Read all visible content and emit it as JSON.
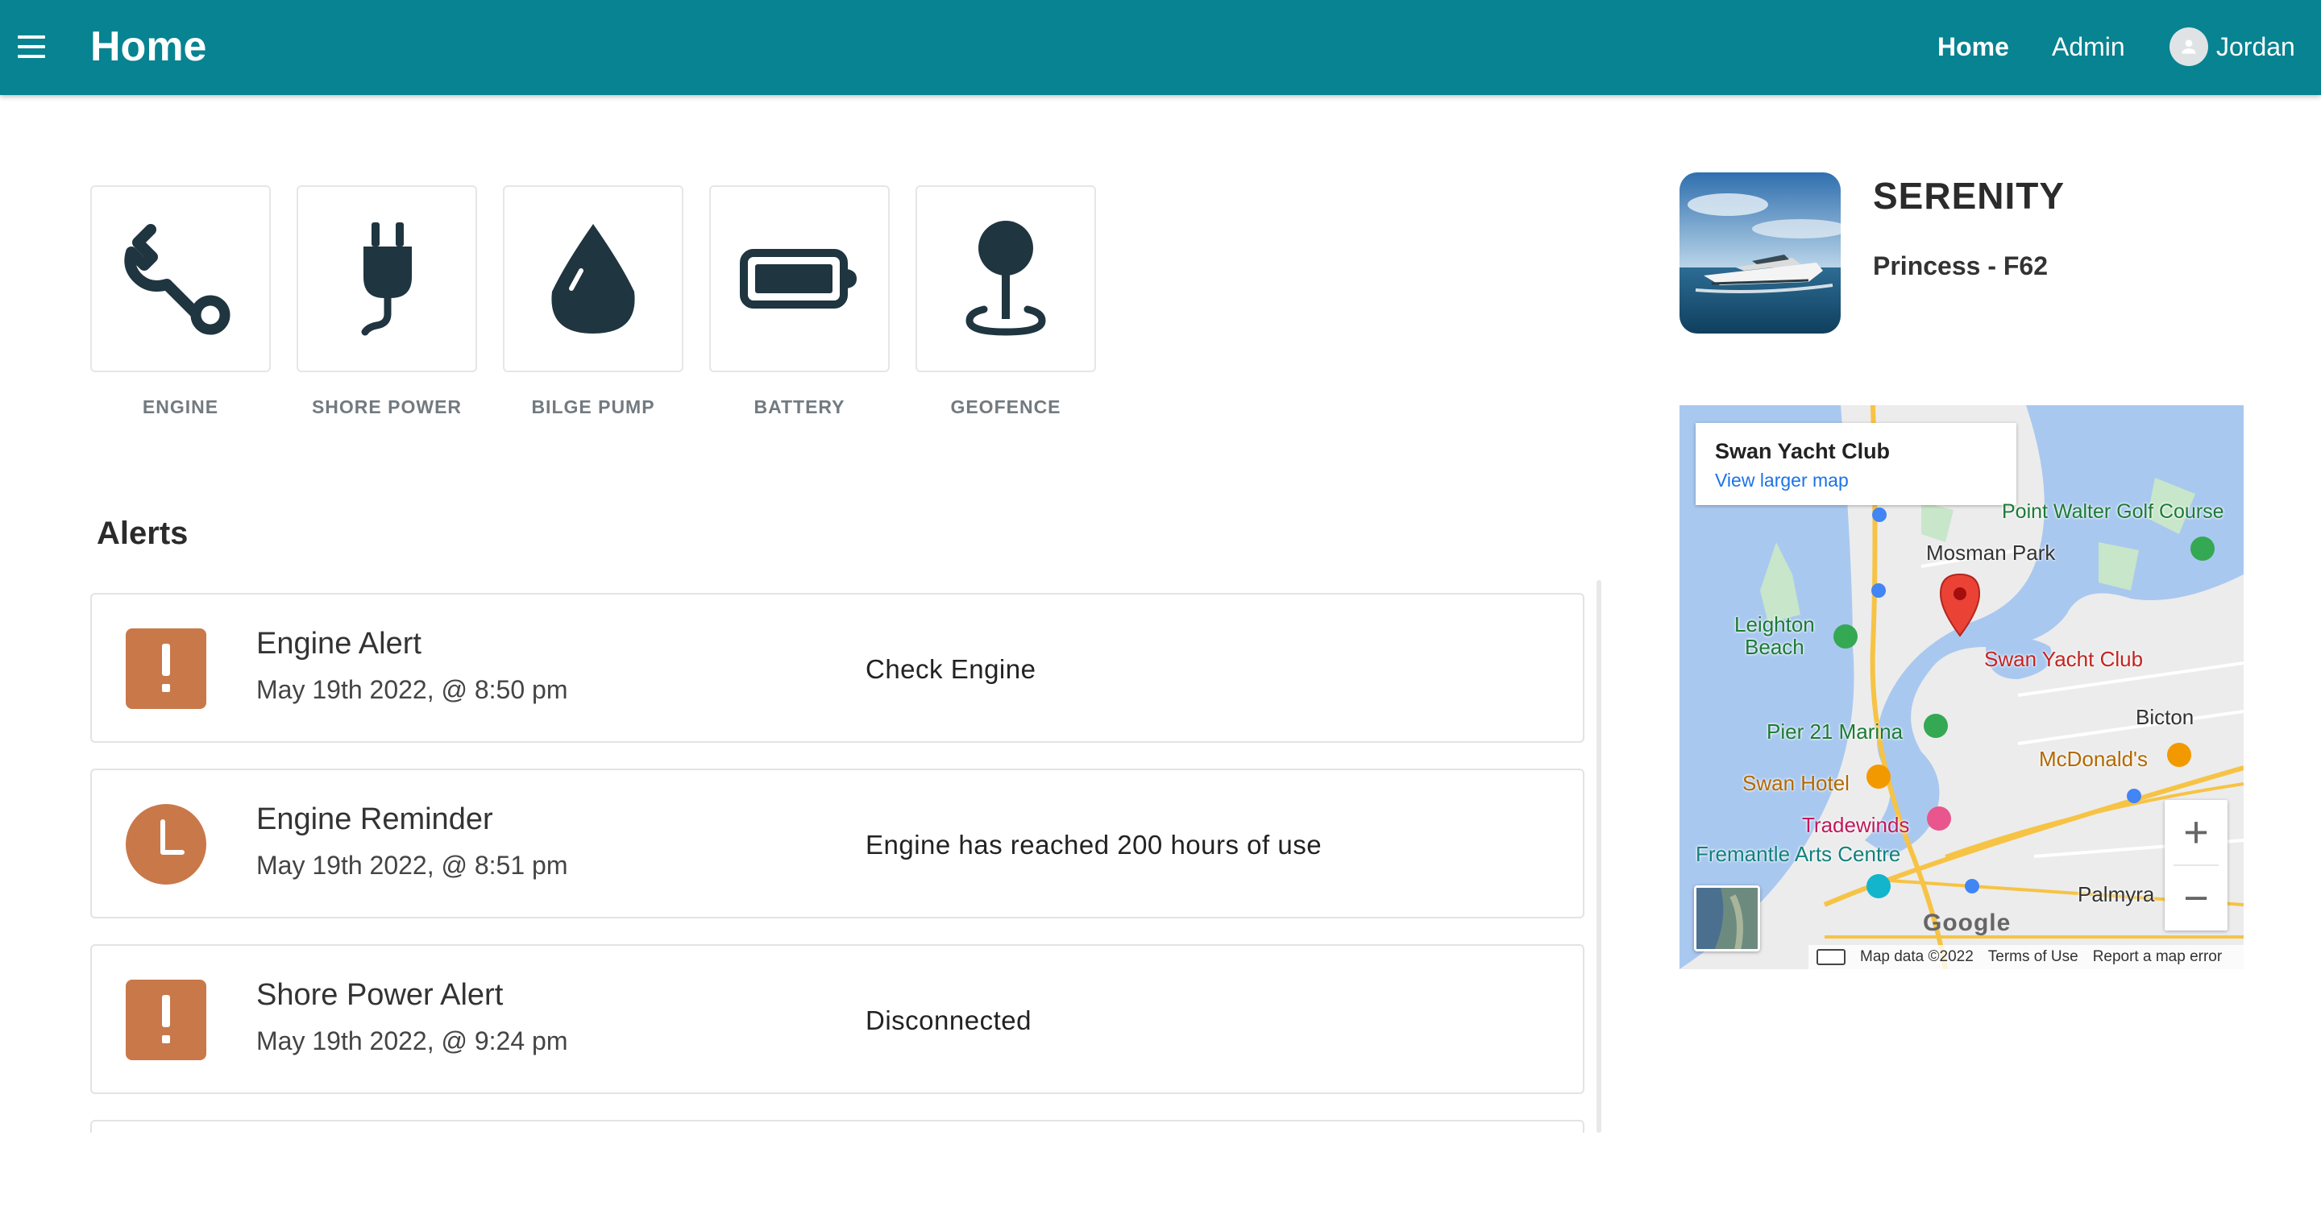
{
  "header": {
    "title": "Home",
    "nav": {
      "home": "Home",
      "admin": "Admin"
    },
    "user_name": "Jordan"
  },
  "status_tiles": [
    {
      "label": "ENGINE",
      "icon": "wrench-icon"
    },
    {
      "label": "SHORE POWER",
      "icon": "plug-icon"
    },
    {
      "label": "BILGE PUMP",
      "icon": "water-drop-icon"
    },
    {
      "label": "BATTERY",
      "icon": "battery-icon"
    },
    {
      "label": "GEOFENCE",
      "icon": "location-pin-icon"
    }
  ],
  "alerts": {
    "title": "Alerts",
    "items": [
      {
        "title": "Engine Alert",
        "time": "May 19th 2022, @ 8:50 pm",
        "message": "Check Engine",
        "icon": "exclamation-icon"
      },
      {
        "title": "Engine Reminder",
        "time": "May 19th 2022, @ 8:51 pm",
        "message": "Engine has reached 200 hours of use",
        "icon": "clock-icon"
      },
      {
        "title": "Shore Power Alert",
        "time": "May 19th 2022, @ 9:24 pm",
        "message": "Disconnected",
        "icon": "exclamation-icon"
      }
    ]
  },
  "vessel": {
    "name": "SERENITY",
    "model": "Princess - F62"
  },
  "map": {
    "place_title": "Swan Yacht Club",
    "larger_map_link": "View larger map",
    "labels": {
      "point_walter": "Point Walter Golf Course",
      "mosman_park": "Mosman Park",
      "leighton_beach": "Leighton\nBeach",
      "swan_yacht_club": "Swan Yacht Club",
      "bicton": "Bicton",
      "pier21": "Pier 21 Marina",
      "mcdonalds": "McDonald's",
      "swan_hotel": "Swan Hotel",
      "tradewinds": "Tradewinds",
      "fremantle_arts": "Fremantle Arts Centre",
      "palmyra": "Palmyra",
      "google": "Google"
    },
    "zoom_in": "+",
    "zoom_out": "−",
    "attribution": {
      "map_data": "Map data ©2022",
      "terms": "Terms of Use",
      "report": "Report a map error"
    }
  },
  "colors": {
    "header": "#078391",
    "alert_icon": "#c9784a",
    "icon_dark": "#1f3540"
  }
}
